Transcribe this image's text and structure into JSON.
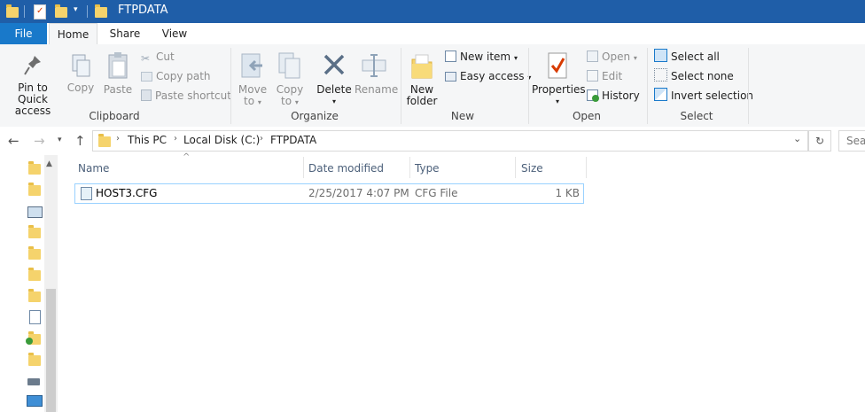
{
  "window": {
    "title": "FTPDATA"
  },
  "ribbon_tabs": [
    "File",
    "Home",
    "Share",
    "View"
  ],
  "ribbon": {
    "clipboard": {
      "label": "Clipboard",
      "pin_line1": "Pin to Quick",
      "pin_line2": "access",
      "copy": "Copy",
      "paste": "Paste",
      "cut": "Cut",
      "copy_path": "Copy path",
      "paste_shortcut": "Paste shortcut"
    },
    "organize": {
      "label": "Organize",
      "move_to_line1": "Move",
      "move_to_line2": "to",
      "copy_to_line1": "Copy",
      "copy_to_line2": "to",
      "delete": "Delete",
      "rename": "Rename"
    },
    "new": {
      "label": "New",
      "new_folder_line1": "New",
      "new_folder_line2": "folder",
      "new_item": "New item",
      "easy_access": "Easy access"
    },
    "open": {
      "label": "Open",
      "properties": "Properties",
      "open": "Open",
      "edit": "Edit",
      "history": "History"
    },
    "select": {
      "label": "Select",
      "select_all": "Select all",
      "select_none": "Select none",
      "invert_selection": "Invert selection"
    }
  },
  "address": {
    "breadcrumb": [
      "This PC",
      "Local Disk (C:)",
      "FTPDATA"
    ],
    "search_placeholder": "Sear"
  },
  "columns": [
    "Name",
    "Date modified",
    "Type",
    "Size"
  ],
  "files": [
    {
      "name": "HOST3.CFG",
      "date": "2/25/2017 4:07 PM",
      "type": "CFG File",
      "size": "1 KB"
    }
  ],
  "colors": {
    "titlebar": "#1f5ea8",
    "file_tab": "#1979ca",
    "selection_border": "#99d1ff"
  }
}
